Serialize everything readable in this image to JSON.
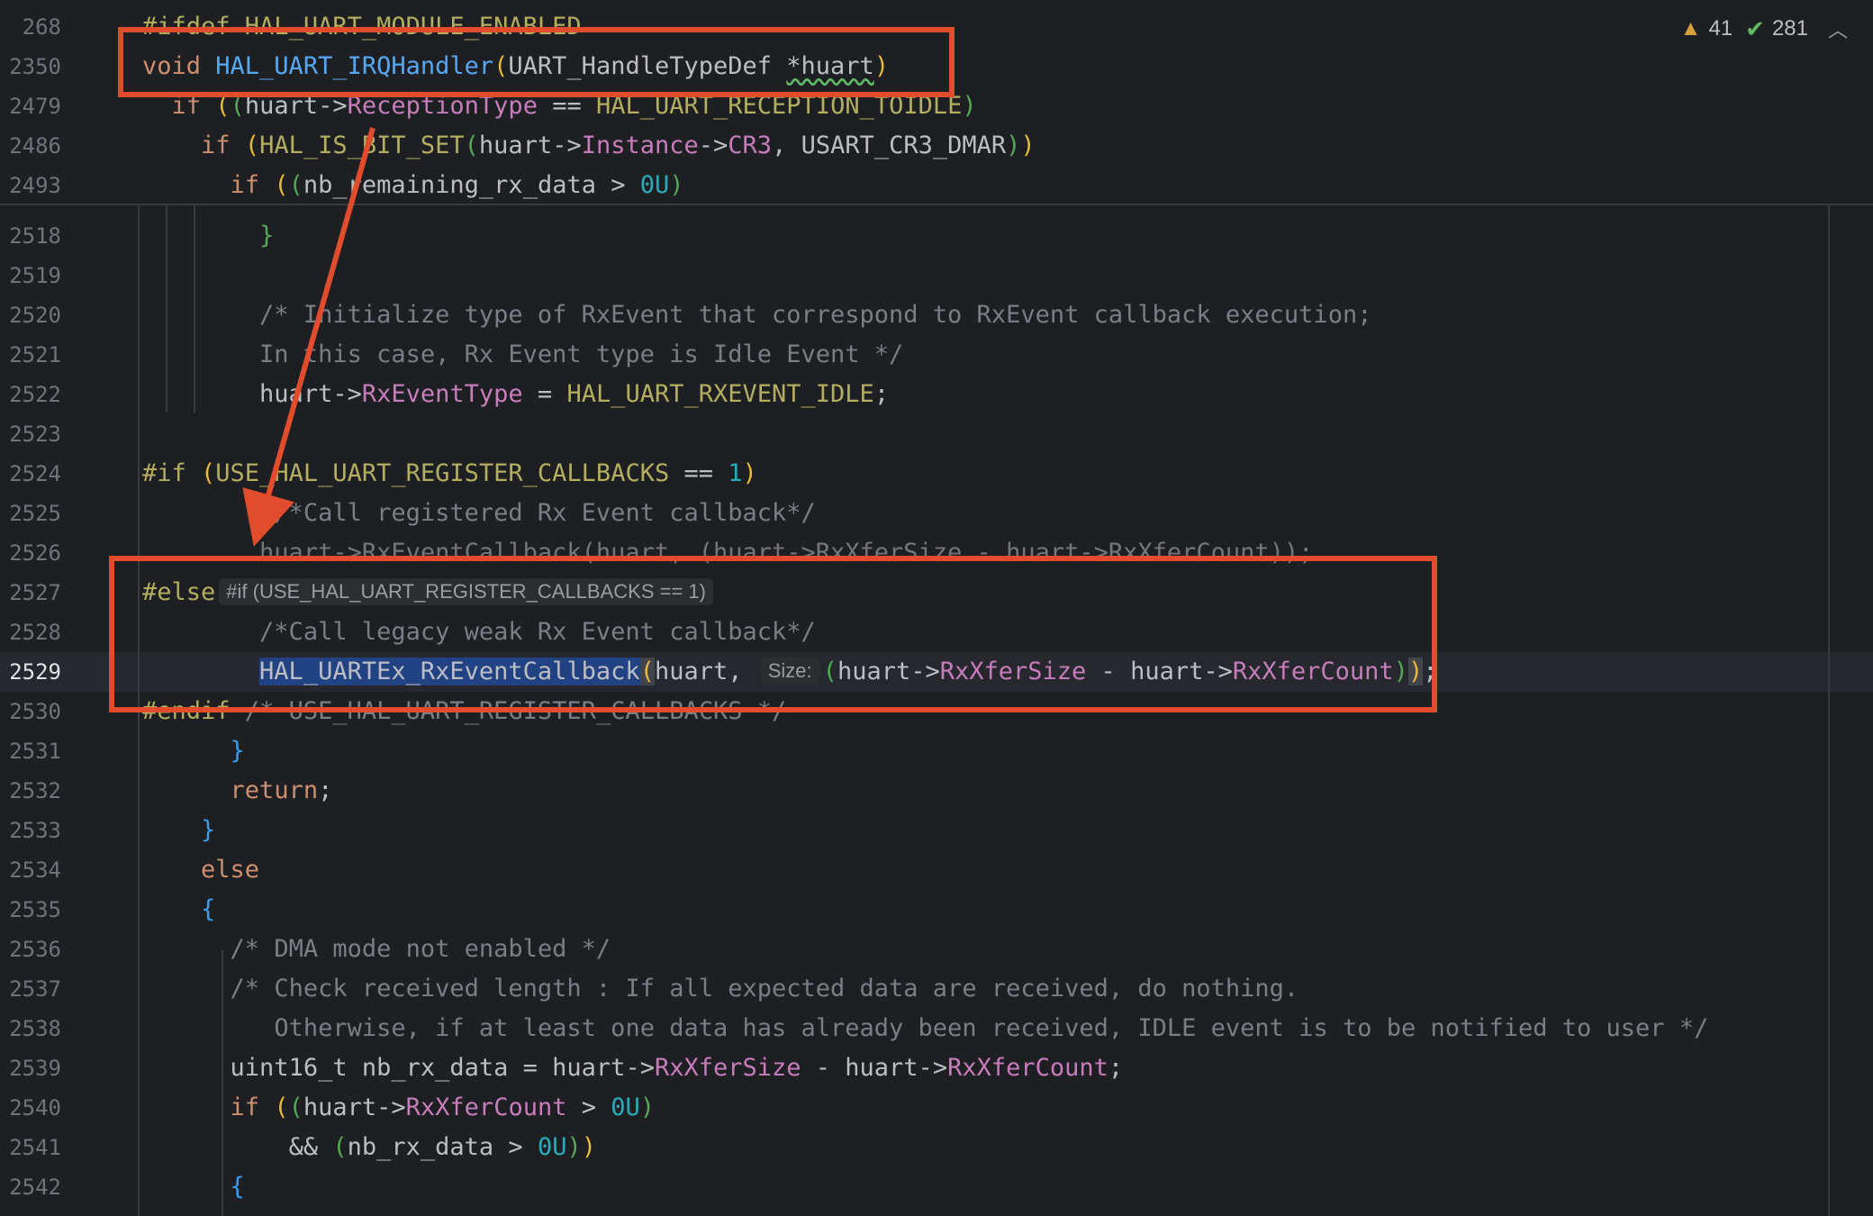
{
  "status": {
    "warnings": "41",
    "weak_warnings": "281"
  },
  "sticky": [
    {
      "ln": "268",
      "pre": "",
      "tokens": [
        [
          "pp",
          "#ifdef "
        ],
        [
          "mac",
          "HAL_UART_MODULE_ENABLED"
        ]
      ]
    },
    {
      "ln": "2350",
      "pre": "",
      "tokens": [
        [
          "kw",
          "void "
        ],
        [
          "fn",
          "HAL_UART_IRQHandler"
        ],
        [
          "br1",
          "("
        ],
        [
          "",
          "UART_HandleTypeDef "
        ],
        [
          "sq",
          "*huart"
        ],
        [
          "br1",
          ")"
        ]
      ]
    },
    {
      "ln": "2479",
      "pre": "  ",
      "tokens": [
        [
          "kw",
          "if "
        ],
        [
          "br1",
          "("
        ],
        [
          "br2",
          "("
        ],
        [
          "",
          "huart->"
        ],
        [
          "fld",
          "ReceptionType"
        ],
        [
          "",
          " == "
        ],
        [
          "mac",
          "HAL_UART_RECEPTION_TOIDLE"
        ],
        [
          "br2",
          ")"
        ]
      ]
    },
    {
      "ln": "2486",
      "pre": "    ",
      "tokens": [
        [
          "kw",
          "if "
        ],
        [
          "br1",
          "("
        ],
        [
          "mac",
          "HAL_IS_BIT_SET"
        ],
        [
          "br2",
          "("
        ],
        [
          "",
          "huart->"
        ],
        [
          "fld",
          "Instance"
        ],
        [
          "",
          "->"
        ],
        [
          "fld",
          "CR3"
        ],
        [
          "",
          ", USART_CR3_DMAR"
        ],
        [
          "br2",
          ")"
        ],
        [
          "br1",
          ")"
        ]
      ]
    },
    {
      "ln": "2493",
      "pre": "      ",
      "tokens": [
        [
          "kw",
          "if "
        ],
        [
          "br1",
          "("
        ],
        [
          "br2",
          "("
        ],
        [
          "",
          "nb_remaining_rx_data > "
        ],
        [
          "num",
          "0U"
        ],
        [
          "br2",
          ")"
        ]
      ]
    }
  ],
  "lines": [
    {
      "ln": "2518",
      "pre": "        ",
      "tokens": [
        [
          "br2",
          "}"
        ]
      ]
    },
    {
      "ln": "2519",
      "pre": "",
      "tokens": []
    },
    {
      "ln": "2520",
      "pre": "        ",
      "tokens": [
        [
          "cm",
          "/* Initialize type of RxEvent that correspond to RxEvent callback execution;"
        ]
      ]
    },
    {
      "ln": "2521",
      "pre": "        ",
      "tokens": [
        [
          "cm",
          "In this case, Rx Event type is Idle Event */"
        ]
      ]
    },
    {
      "ln": "2522",
      "pre": "        ",
      "tokens": [
        [
          "",
          "huart->"
        ],
        [
          "fld",
          "RxEventType"
        ],
        [
          "",
          " = "
        ],
        [
          "mac",
          "HAL_UART_RXEVENT_IDLE"
        ],
        [
          "",
          ";"
        ]
      ]
    },
    {
      "ln": "2523",
      "pre": "",
      "tokens": []
    },
    {
      "ln": "2524",
      "pre": "",
      "tokens": [
        [
          "pp",
          "#if "
        ],
        [
          "br1",
          "("
        ],
        [
          "mac",
          "USE_HAL_UART_REGISTER_CALLBACKS"
        ],
        [
          "",
          " == "
        ],
        [
          "num",
          "1"
        ],
        [
          "br1",
          ")"
        ]
      ]
    },
    {
      "ln": "2525",
      "pre": "         ",
      "tokens": [
        [
          "cm",
          "/*Call registered Rx Event callback*/"
        ]
      ]
    },
    {
      "ln": "2526",
      "pre": "        ",
      "tokens": [
        [
          "dim",
          "huart->RxEventCallback(huart, (huart->RxXferSize - huart->RxXferCount));"
        ]
      ]
    },
    {
      "ln": "2527",
      "pre": "",
      "tokens": [
        [
          "pp",
          "#else"
        ],
        [
          "hint",
          "#if (USE_HAL_UART_REGISTER_CALLBACKS == 1)"
        ]
      ]
    },
    {
      "ln": "2528",
      "pre": "        ",
      "tokens": [
        [
          "cm",
          "/*Call legacy weak Rx Event callback*/"
        ]
      ]
    },
    {
      "ln": "2529",
      "pre": "        ",
      "current": true,
      "tokens": [
        [
          "sel",
          "HAL_UARTEx_RxEventCallback"
        ],
        [
          "brm",
          "("
        ],
        [
          "",
          "huart, "
        ],
        [
          "hint",
          "Size:"
        ],
        [
          "br2",
          "("
        ],
        [
          "",
          "huart->"
        ],
        [
          "fld",
          "RxXferSize"
        ],
        [
          "",
          " - huart->"
        ],
        [
          "fld",
          "RxXferCount"
        ],
        [
          "br2",
          ")"
        ],
        [
          "brm",
          ")"
        ],
        [
          "",
          ";"
        ]
      ]
    },
    {
      "ln": "2530",
      "pre": "",
      "tokens": [
        [
          "pp",
          "#endif "
        ],
        [
          "cm",
          "/* USE_HAL_UART_REGISTER_CALLBACKS */"
        ]
      ]
    },
    {
      "ln": "2531",
      "pre": "      ",
      "tokens": [
        [
          "br3",
          "}"
        ]
      ]
    },
    {
      "ln": "2532",
      "pre": "      ",
      "tokens": [
        [
          "kw",
          "return"
        ],
        [
          "",
          ";"
        ]
      ]
    },
    {
      "ln": "2533",
      "pre": "    ",
      "tokens": [
        [
          "br3",
          "}"
        ]
      ]
    },
    {
      "ln": "2534",
      "pre": "    ",
      "tokens": [
        [
          "kw",
          "else"
        ]
      ]
    },
    {
      "ln": "2535",
      "pre": "    ",
      "tokens": [
        [
          "br3",
          "{"
        ]
      ]
    },
    {
      "ln": "2536",
      "pre": "      ",
      "tokens": [
        [
          "cm",
          "/* DMA mode not enabled */"
        ]
      ]
    },
    {
      "ln": "2537",
      "pre": "      ",
      "tokens": [
        [
          "cm",
          "/* Check received length : If all expected data are received, do nothing."
        ]
      ]
    },
    {
      "ln": "2538",
      "pre": "         ",
      "tokens": [
        [
          "cm",
          "Otherwise, if at least one data has already been received, IDLE event is to be notified to user */"
        ]
      ]
    },
    {
      "ln": "2539",
      "pre": "      ",
      "tokens": [
        [
          "",
          "uint16_t nb_rx_data = huart->"
        ],
        [
          "fld",
          "RxXferSize"
        ],
        [
          "",
          " - huart->"
        ],
        [
          "fld",
          "RxXferCount"
        ],
        [
          "",
          ";"
        ]
      ]
    },
    {
      "ln": "2540",
      "pre": "      ",
      "tokens": [
        [
          "kw",
          "if "
        ],
        [
          "br1",
          "("
        ],
        [
          "br2",
          "("
        ],
        [
          "",
          "huart->"
        ],
        [
          "fld",
          "RxXferCount"
        ],
        [
          "",
          " > "
        ],
        [
          "num",
          "0U"
        ],
        [
          "br2",
          ")"
        ]
      ]
    },
    {
      "ln": "2541",
      "pre": "          ",
      "tokens": [
        [
          "",
          "&& "
        ],
        [
          "br2",
          "("
        ],
        [
          "",
          "nb_rx_data > "
        ],
        [
          "num",
          "0U"
        ],
        [
          "br2",
          ")"
        ],
        [
          "br1",
          ")"
        ]
      ]
    },
    {
      "ln": "2542",
      "pre": "      ",
      "tokens": [
        [
          "br3",
          "{"
        ]
      ]
    }
  ],
  "colors": {
    "annotation": "#e14c2c",
    "background": "#1e1f22",
    "selection": "#214283"
  }
}
